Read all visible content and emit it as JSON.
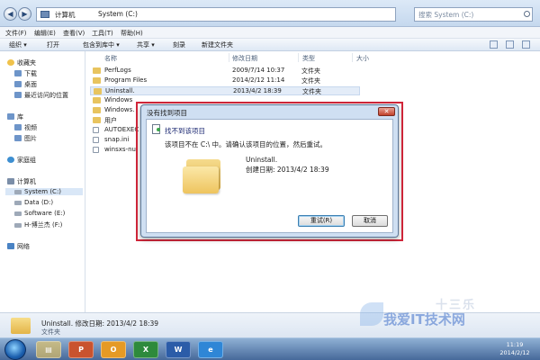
{
  "address": {
    "segments": [
      "计算机",
      "System (C:)"
    ],
    "search_placeholder": "搜索 System (C:)"
  },
  "menu": [
    "文件(F)",
    "编辑(E)",
    "查看(V)",
    "工具(T)",
    "帮助(H)"
  ],
  "toolbar": [
    "组织 ▾",
    "打开",
    "包含到库中 ▾",
    "共享 ▾",
    "刻录",
    "新建文件夹"
  ],
  "columns": {
    "name": "名称",
    "date": "修改日期",
    "type": "类型",
    "size": "大小"
  },
  "nav": {
    "favorites": "收藏夹",
    "favorites_items": [
      "下载",
      "桌面",
      "最近访问的位置"
    ],
    "libraries": "库",
    "libraries_items": [
      "视频",
      "图片"
    ],
    "homegroup": "家庭组",
    "computer": "计算机",
    "drives": [
      "System (C:)",
      "Data (D:)",
      "Software (E:)",
      "H-博兰杰 (F:)"
    ],
    "network": "网络"
  },
  "files": [
    {
      "name": "PerfLogs",
      "date": "2009/7/14 10:37",
      "type": "文件夹",
      "kind": "folder"
    },
    {
      "name": "Program Files",
      "date": "2014/2/12 11:14",
      "type": "文件夹",
      "kind": "folder"
    },
    {
      "name": "Uninstall.",
      "date": "2013/4/2 18:39",
      "type": "文件夹",
      "kind": "folder"
    },
    {
      "name": "Windows",
      "date": "",
      "type": "",
      "kind": "folder"
    },
    {
      "name": "Windows.",
      "date": "",
      "type": "",
      "kind": "folder"
    },
    {
      "name": "用户",
      "date": "",
      "type": "",
      "kind": "folder"
    },
    {
      "name": "AUTOEXEC",
      "date": "",
      "type": "",
      "kind": "file"
    },
    {
      "name": "snap.ini",
      "date": "",
      "type": "",
      "kind": "file"
    },
    {
      "name": "winsxs-nul",
      "date": "",
      "type": "",
      "kind": "file"
    }
  ],
  "details": {
    "line1": "Uninstall.  修改日期: 2013/4/2 18:39",
    "line2": "文件夹"
  },
  "dialog": {
    "title": "没有找到项目",
    "heading": "找不到该项目",
    "message": "该项目不在 C:\\ 中。请确认该项目的位置，然后重试。",
    "item_name": "Uninstall.",
    "item_date": "创建日期: 2013/4/2 18:39",
    "retry": "重试(R)",
    "cancel": "取消"
  },
  "taskbar": {
    "apps": [
      "P",
      "O",
      "X",
      "W",
      "e"
    ],
    "time": "11:19",
    "date": "2014/2/12"
  },
  "watermark": {
    "text": "我爱IT技术网",
    "brand": "十三乐"
  },
  "colors": {
    "accent": "#3c7fb1",
    "highlight": "#d2263a",
    "folder": "#e8c45f"
  }
}
